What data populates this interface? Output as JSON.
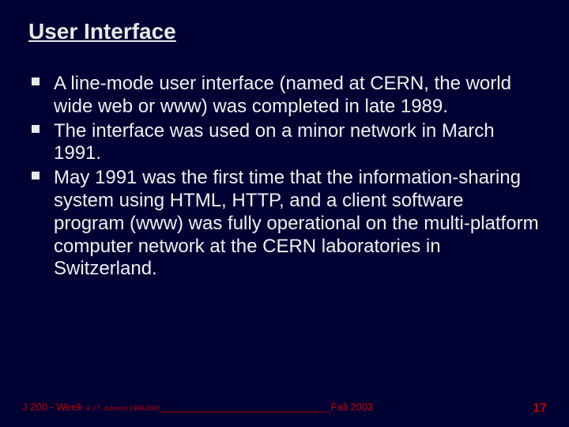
{
  "title": "User Interface",
  "bullets": [
    "A line-mode user interface (named at CERN, the world wide web or www) was completed in late 1989.",
    "The interface was used on a minor network in March 1991.",
    "May 1991 was the first time that the information-sharing system using HTML, HTTP, and a client software program (www) was fully operational on the multi-platform computer network at the CERN laboratories in Switzerland."
  ],
  "footer": {
    "course": "J 200 - Week",
    "copyright": "© J.T. Johnson 1999-2003",
    "line": "______________________________",
    "term": "Fall 2003"
  },
  "page_number": "17"
}
